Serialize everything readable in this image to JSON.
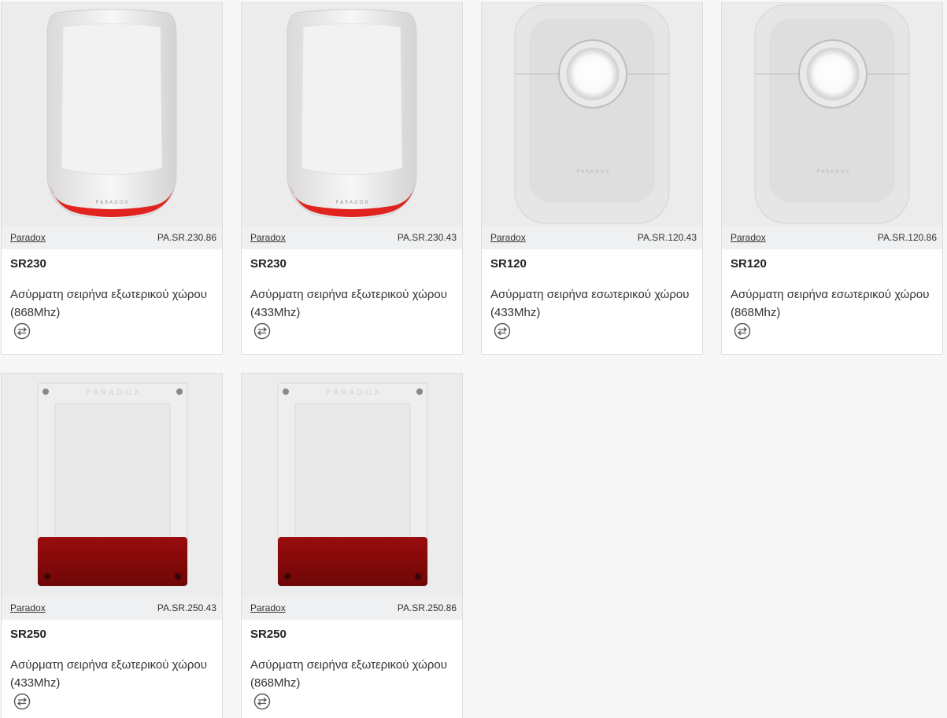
{
  "products": [
    {
      "brand": "Paradox",
      "sku": "PA.SR.230.86",
      "title": "SR230",
      "description": "Ασύρματη σειρήνα εξωτερικού χώρου (868Mhz)",
      "image": "sr230-outdoor-siren-red-base",
      "compare_icon": "compare-arrows-icon"
    },
    {
      "brand": "Paradox",
      "sku": "PA.SR.230.43",
      "title": "SR230",
      "description": "Ασύρματη σειρήνα εξωτερικού χώρου (433Mhz)",
      "image": "sr230-outdoor-siren-red-base",
      "compare_icon": "compare-arrows-icon"
    },
    {
      "brand": "Paradox",
      "sku": "PA.SR.120.43",
      "title": "SR120",
      "description": "Ασύρματη σειρήνα εσωτερικού χώρου (433Mhz)",
      "image": "sr120-indoor-siren-white",
      "compare_icon": "compare-arrows-icon"
    },
    {
      "brand": "Paradox",
      "sku": "PA.SR.120.86",
      "title": "SR120",
      "description": "Ασύρματη σειρήνα εσωτερικού χώρου (868Mhz)",
      "image": "sr120-indoor-siren-white",
      "compare_icon": "compare-arrows-icon"
    },
    {
      "brand": "Paradox",
      "sku": "PA.SR.250.43",
      "title": "SR250",
      "description": "Ασύρματη σειρήνα εξωτερικού χώρου (433Mhz)",
      "image": "sr250-outdoor-siren-red-strobe",
      "compare_icon": "compare-arrows-icon"
    },
    {
      "brand": "Paradox",
      "sku": "PA.SR.250.86",
      "title": "SR250",
      "description": "Ασύρματη σειρήνα εξωτερικού χώρου (868Mhz)",
      "image": "sr250-outdoor-siren-red-strobe",
      "compare_icon": "compare-arrows-icon"
    }
  ],
  "colors": {
    "page_bg": "#f7f7f7",
    "card_bg": "#ffffff",
    "image_bg": "#ececec",
    "meta_bg": "#eff0f2",
    "siren_red": "#e0231f",
    "strobe_dark_red": "#8a0a0a"
  }
}
